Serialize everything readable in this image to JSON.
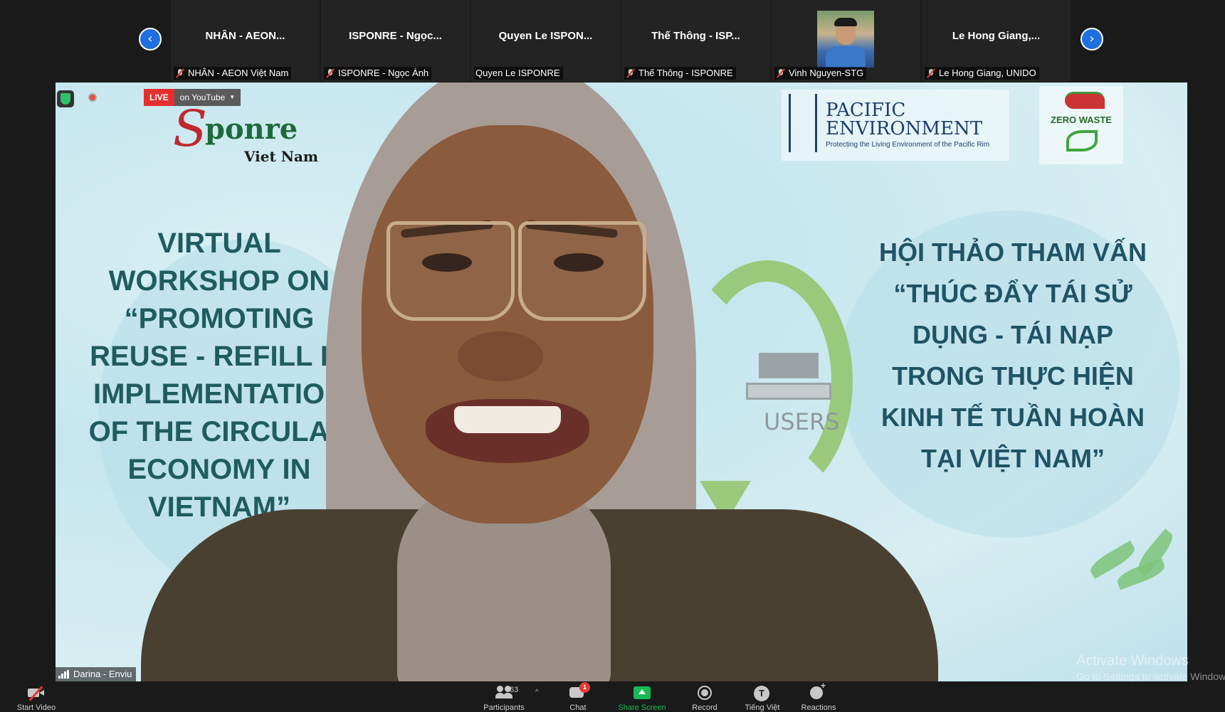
{
  "gallery": {
    "prev_icon": "chevron-left-icon",
    "next_icon": "chevron-right-icon",
    "tiles": [
      {
        "name": "NHÂN - AEON...",
        "label": "NHÂN - AEON Việt Nam",
        "muted": true
      },
      {
        "name": "ISPONRE - Ngọc...",
        "label": "ISPONRE - Ngọc Ánh",
        "muted": true
      },
      {
        "name": "Quyen Le ISPON...",
        "label": "Quyen Le ISPONRE",
        "muted": false
      },
      {
        "name": "Thế Thông - ISP...",
        "label": "Thế Thông - ISPONRE",
        "muted": true
      },
      {
        "name": "",
        "label": "Vinh Nguyen-STG",
        "muted": true
      },
      {
        "name": "Le Hong Giang,...",
        "label": "Le Hong Giang, UNIDO",
        "muted": true
      }
    ]
  },
  "stream": {
    "live_label": "LIVE",
    "live_target": "on YouTube"
  },
  "slide": {
    "isponre_word": "ponre",
    "isponre_sub": "Viet Nam",
    "pacific_line1": "PACIFIC",
    "pacific_line2": "ENVIRONMENT",
    "pacific_tagline": "Protecting the Living Environment of the Pacific Rim",
    "zero_waste": "ZERO WASTE",
    "title_en": "VIRTUAL\nWORKSHOP ON\n“PROMOTING\nREUSE - REFILL IN\nIMPLEMENTATION\nOF THE CIRCULAR\nECONOMY IN\nVIETNAM”",
    "title_vi": "HỘI THẢO THAM VẤN\n“THÚC ĐẨY TÁI SỬ\nDỤNG - TÁI NẠP\nTRONG THỰC HIỆN\nKINH TẾ TUẦN HOÀN\nTẠI VIỆT NAM”",
    "users_label": "USERS"
  },
  "speaker": {
    "name_tag": "Darina - Enviu"
  },
  "watermark": {
    "line1": "Activate Windows",
    "line2": "Go to Settings to activate Windows."
  },
  "toolbar": {
    "start_video": "Start Video",
    "participants": "Participants",
    "participants_count": "63",
    "chat": "Chat",
    "chat_badge": "1",
    "share_screen": "Share Screen",
    "record": "Record",
    "language": "Tiếng Việt",
    "language_glyph": "T",
    "reactions": "Reactions",
    "colors": {
      "share": "#19b955",
      "badge": "#e53935",
      "live": "#e42f2f",
      "nav": "#1f6fe0"
    }
  }
}
